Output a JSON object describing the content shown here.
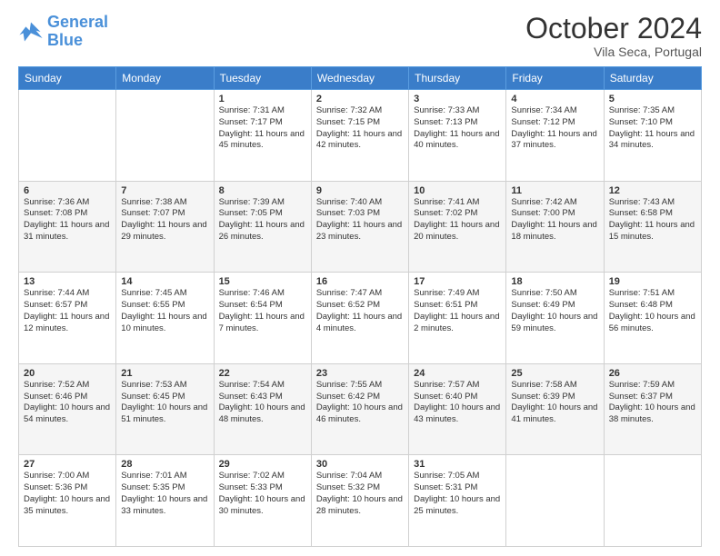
{
  "header": {
    "logo_line1": "General",
    "logo_line2": "Blue",
    "month": "October 2024",
    "location": "Vila Seca, Portugal"
  },
  "weekdays": [
    "Sunday",
    "Monday",
    "Tuesday",
    "Wednesday",
    "Thursday",
    "Friday",
    "Saturday"
  ],
  "weeks": [
    [
      {
        "day": "",
        "sunrise": "",
        "sunset": "",
        "daylight": ""
      },
      {
        "day": "",
        "sunrise": "",
        "sunset": "",
        "daylight": ""
      },
      {
        "day": "1",
        "sunrise": "Sunrise: 7:31 AM",
        "sunset": "Sunset: 7:17 PM",
        "daylight": "Daylight: 11 hours and 45 minutes."
      },
      {
        "day": "2",
        "sunrise": "Sunrise: 7:32 AM",
        "sunset": "Sunset: 7:15 PM",
        "daylight": "Daylight: 11 hours and 42 minutes."
      },
      {
        "day": "3",
        "sunrise": "Sunrise: 7:33 AM",
        "sunset": "Sunset: 7:13 PM",
        "daylight": "Daylight: 11 hours and 40 minutes."
      },
      {
        "day": "4",
        "sunrise": "Sunrise: 7:34 AM",
        "sunset": "Sunset: 7:12 PM",
        "daylight": "Daylight: 11 hours and 37 minutes."
      },
      {
        "day": "5",
        "sunrise": "Sunrise: 7:35 AM",
        "sunset": "Sunset: 7:10 PM",
        "daylight": "Daylight: 11 hours and 34 minutes."
      }
    ],
    [
      {
        "day": "6",
        "sunrise": "Sunrise: 7:36 AM",
        "sunset": "Sunset: 7:08 PM",
        "daylight": "Daylight: 11 hours and 31 minutes."
      },
      {
        "day": "7",
        "sunrise": "Sunrise: 7:38 AM",
        "sunset": "Sunset: 7:07 PM",
        "daylight": "Daylight: 11 hours and 29 minutes."
      },
      {
        "day": "8",
        "sunrise": "Sunrise: 7:39 AM",
        "sunset": "Sunset: 7:05 PM",
        "daylight": "Daylight: 11 hours and 26 minutes."
      },
      {
        "day": "9",
        "sunrise": "Sunrise: 7:40 AM",
        "sunset": "Sunset: 7:03 PM",
        "daylight": "Daylight: 11 hours and 23 minutes."
      },
      {
        "day": "10",
        "sunrise": "Sunrise: 7:41 AM",
        "sunset": "Sunset: 7:02 PM",
        "daylight": "Daylight: 11 hours and 20 minutes."
      },
      {
        "day": "11",
        "sunrise": "Sunrise: 7:42 AM",
        "sunset": "Sunset: 7:00 PM",
        "daylight": "Daylight: 11 hours and 18 minutes."
      },
      {
        "day": "12",
        "sunrise": "Sunrise: 7:43 AM",
        "sunset": "Sunset: 6:58 PM",
        "daylight": "Daylight: 11 hours and 15 minutes."
      }
    ],
    [
      {
        "day": "13",
        "sunrise": "Sunrise: 7:44 AM",
        "sunset": "Sunset: 6:57 PM",
        "daylight": "Daylight: 11 hours and 12 minutes."
      },
      {
        "day": "14",
        "sunrise": "Sunrise: 7:45 AM",
        "sunset": "Sunset: 6:55 PM",
        "daylight": "Daylight: 11 hours and 10 minutes."
      },
      {
        "day": "15",
        "sunrise": "Sunrise: 7:46 AM",
        "sunset": "Sunset: 6:54 PM",
        "daylight": "Daylight: 11 hours and 7 minutes."
      },
      {
        "day": "16",
        "sunrise": "Sunrise: 7:47 AM",
        "sunset": "Sunset: 6:52 PM",
        "daylight": "Daylight: 11 hours and 4 minutes."
      },
      {
        "day": "17",
        "sunrise": "Sunrise: 7:49 AM",
        "sunset": "Sunset: 6:51 PM",
        "daylight": "Daylight: 11 hours and 2 minutes."
      },
      {
        "day": "18",
        "sunrise": "Sunrise: 7:50 AM",
        "sunset": "Sunset: 6:49 PM",
        "daylight": "Daylight: 10 hours and 59 minutes."
      },
      {
        "day": "19",
        "sunrise": "Sunrise: 7:51 AM",
        "sunset": "Sunset: 6:48 PM",
        "daylight": "Daylight: 10 hours and 56 minutes."
      }
    ],
    [
      {
        "day": "20",
        "sunrise": "Sunrise: 7:52 AM",
        "sunset": "Sunset: 6:46 PM",
        "daylight": "Daylight: 10 hours and 54 minutes."
      },
      {
        "day": "21",
        "sunrise": "Sunrise: 7:53 AM",
        "sunset": "Sunset: 6:45 PM",
        "daylight": "Daylight: 10 hours and 51 minutes."
      },
      {
        "day": "22",
        "sunrise": "Sunrise: 7:54 AM",
        "sunset": "Sunset: 6:43 PM",
        "daylight": "Daylight: 10 hours and 48 minutes."
      },
      {
        "day": "23",
        "sunrise": "Sunrise: 7:55 AM",
        "sunset": "Sunset: 6:42 PM",
        "daylight": "Daylight: 10 hours and 46 minutes."
      },
      {
        "day": "24",
        "sunrise": "Sunrise: 7:57 AM",
        "sunset": "Sunset: 6:40 PM",
        "daylight": "Daylight: 10 hours and 43 minutes."
      },
      {
        "day": "25",
        "sunrise": "Sunrise: 7:58 AM",
        "sunset": "Sunset: 6:39 PM",
        "daylight": "Daylight: 10 hours and 41 minutes."
      },
      {
        "day": "26",
        "sunrise": "Sunrise: 7:59 AM",
        "sunset": "Sunset: 6:37 PM",
        "daylight": "Daylight: 10 hours and 38 minutes."
      }
    ],
    [
      {
        "day": "27",
        "sunrise": "Sunrise: 7:00 AM",
        "sunset": "Sunset: 5:36 PM",
        "daylight": "Daylight: 10 hours and 35 minutes."
      },
      {
        "day": "28",
        "sunrise": "Sunrise: 7:01 AM",
        "sunset": "Sunset: 5:35 PM",
        "daylight": "Daylight: 10 hours and 33 minutes."
      },
      {
        "day": "29",
        "sunrise": "Sunrise: 7:02 AM",
        "sunset": "Sunset: 5:33 PM",
        "daylight": "Daylight: 10 hours and 30 minutes."
      },
      {
        "day": "30",
        "sunrise": "Sunrise: 7:04 AM",
        "sunset": "Sunset: 5:32 PM",
        "daylight": "Daylight: 10 hours and 28 minutes."
      },
      {
        "day": "31",
        "sunrise": "Sunrise: 7:05 AM",
        "sunset": "Sunset: 5:31 PM",
        "daylight": "Daylight: 10 hours and 25 minutes."
      },
      {
        "day": "",
        "sunrise": "",
        "sunset": "",
        "daylight": ""
      },
      {
        "day": "",
        "sunrise": "",
        "sunset": "",
        "daylight": ""
      }
    ]
  ]
}
